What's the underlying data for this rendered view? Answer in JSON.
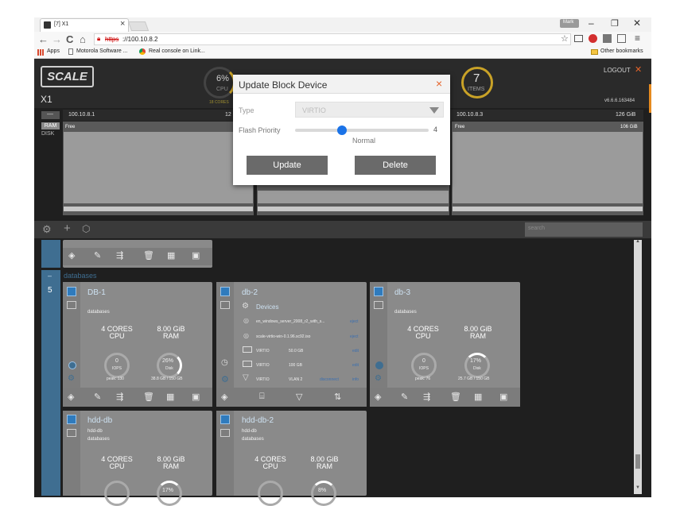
{
  "browser": {
    "tab_title": "[7] X1",
    "tab_close": "×",
    "omnibox_prefix": "https",
    "omnibox_url": "://100.10.8.2",
    "window_user": "Mark",
    "bookmarks": [
      "Apps",
      "Motorola Software ...",
      "Real console on Link..."
    ],
    "other_bookmarks": "Other bookmarks"
  },
  "app": {
    "logo": "SCALE",
    "cluster_name": "X1",
    "logout": "LOGOUT",
    "version": "v6.6.6.163484",
    "cpu_gauge": {
      "value": "6%",
      "label": "CPU",
      "sub": "18 CORES"
    },
    "items_gauge": {
      "value": "7",
      "label": "ITEMS"
    },
    "nodes": [
      {
        "ip": "100.10.8.1",
        "mem": "12"
      },
      {
        "ip": "100.10.8.3",
        "mem": "126 GiB"
      }
    ],
    "node_panels": [
      {
        "free": "Free",
        "free_right": ""
      },
      {
        "free": "Free",
        "free_right": ""
      },
      {
        "free": "Free",
        "free_right": "106 GiB"
      }
    ],
    "side_toggle": "—",
    "side_ram": "RAM",
    "side_disk": "DISK",
    "search_placeholder": "search",
    "group_label": "databases",
    "group_collapse": "–",
    "group_count": "5"
  },
  "modal": {
    "title": "Update Block Device",
    "close": "×",
    "type_label": "Type",
    "type_value": "VIRTIO",
    "flash_label": "Flash Priority",
    "flash_value": "4",
    "flash_fraction": 0.35,
    "flash_text": "Normal",
    "update_button": "Update",
    "delete_button": "Delete"
  },
  "vms": [
    {
      "title": "DB-1",
      "sub": "databases",
      "cores_top": "4 CORES",
      "cores_bottom": "CPU",
      "ram_top": "8.00 GiB",
      "ram_bottom": "RAM",
      "iops_value": "0",
      "iops_label": "IOPS",
      "disk_value": "26%",
      "disk_label": "Disk",
      "peak": "peak: 130",
      "disk_usage": "38.8 GB / 150 GB"
    },
    {
      "title": "db-2",
      "devices_label": "Devices",
      "devices": [
        {
          "name": "en_windows_server_2008_r2_with_s...",
          "action": "eject"
        },
        {
          "name": "scale-virtio-win-0.1.96.sc92.iso",
          "action": "eject"
        },
        {
          "name": "VIRTIO",
          "size": "50.0 GB",
          "action": "edit"
        },
        {
          "name": "VIRTIO",
          "size": "100 GB",
          "action": "edit"
        },
        {
          "name": "VIRTIO",
          "size": "VLAN 2",
          "action": "disconnect",
          "action2": "info"
        }
      ]
    },
    {
      "title": "db-3",
      "sub": "databases",
      "cores_top": "4 CORES",
      "cores_bottom": "CPU",
      "ram_top": "8.00 GiB",
      "ram_bottom": "RAM",
      "iops_value": "0",
      "iops_label": "IOPS",
      "disk_value": "17%",
      "disk_label": "Disk",
      "peak": "peak: 76",
      "disk_usage": "25.7 GB / 150 GB"
    },
    {
      "title": "hdd-db",
      "sub1": "hdd-db",
      "sub": "databases",
      "cores_top": "4 CORES",
      "cores_bottom": "CPU",
      "ram_top": "8.00 GiB",
      "ram_bottom": "RAM",
      "disk_value": "17%"
    },
    {
      "title": "hdd-db-2",
      "sub1": "hdd-db",
      "sub": "databases",
      "cores_top": "4 CORES",
      "cores_bottom": "CPU",
      "ram_top": "8.00 GiB",
      "ram_bottom": "RAM",
      "disk_value": "8%"
    }
  ]
}
